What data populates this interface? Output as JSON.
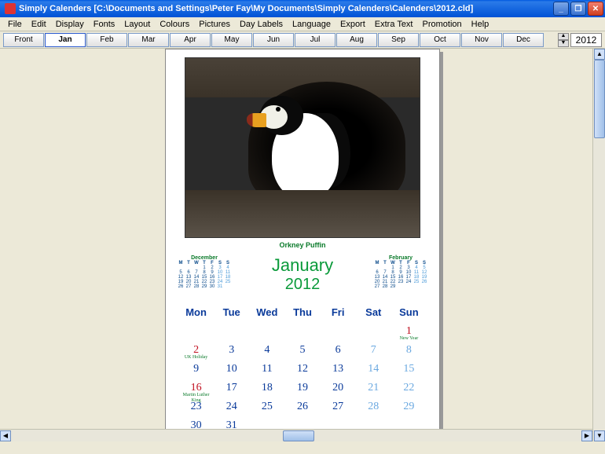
{
  "titlebar": {
    "text": "Simply Calenders [C:\\Documents and Settings\\Peter Fay\\My Documents\\Simply Calenders\\Calenders\\2012.cld]"
  },
  "menu": [
    "File",
    "Edit",
    "Display",
    "Fonts",
    "Layout",
    "Colours",
    "Pictures",
    "Day Labels",
    "Language",
    "Export",
    "Extra Text",
    "Promotion",
    "Help"
  ],
  "tabs": [
    "Front",
    "Jan",
    "Feb",
    "Mar",
    "Apr",
    "May",
    "Jun",
    "Jul",
    "Aug",
    "Sep",
    "Oct",
    "Nov",
    "Dec"
  ],
  "active_tab": "Jan",
  "year": "2012",
  "year_label": "January",
  "photo_caption": "Orkney Puffin",
  "main": {
    "month": "January",
    "year": "2012"
  },
  "day_headers": [
    "Mon",
    "Tue",
    "Wed",
    "Thu",
    "Fri",
    "Sat",
    "Sun"
  ],
  "mini_prev": {
    "name": "December",
    "head": [
      "M",
      "T",
      "W",
      "T",
      "F",
      "S",
      "S"
    ],
    "rows": [
      [
        "",
        "",
        "",
        "1",
        "2",
        "3",
        "4"
      ],
      [
        "5",
        "6",
        "7",
        "8",
        "9",
        "10",
        "11"
      ],
      [
        "12",
        "13",
        "14",
        "15",
        "16",
        "17",
        "18"
      ],
      [
        "19",
        "20",
        "21",
        "22",
        "23",
        "24",
        "25"
      ],
      [
        "26",
        "27",
        "28",
        "29",
        "30",
        "31",
        ""
      ]
    ]
  },
  "mini_next": {
    "name": "February",
    "head": [
      "M",
      "T",
      "W",
      "T",
      "F",
      "S",
      "S"
    ],
    "rows": [
      [
        "",
        "",
        "1",
        "2",
        "3",
        "4",
        "5"
      ],
      [
        "6",
        "7",
        "8",
        "9",
        "10",
        "11",
        "12"
      ],
      [
        "13",
        "14",
        "15",
        "16",
        "17",
        "18",
        "19"
      ],
      [
        "20",
        "21",
        "22",
        "23",
        "24",
        "25",
        "26"
      ],
      [
        "27",
        "28",
        "29",
        "",
        "",
        "",
        ""
      ]
    ]
  },
  "grid": [
    [
      {
        "d": ""
      },
      {
        "d": ""
      },
      {
        "d": ""
      },
      {
        "d": ""
      },
      {
        "d": ""
      },
      {
        "d": ""
      },
      {
        "d": "1",
        "hol": true,
        "note": "New Year"
      }
    ],
    [
      {
        "d": "2",
        "hol": true,
        "note": "UK Holiday"
      },
      {
        "d": "3"
      },
      {
        "d": "4"
      },
      {
        "d": "5"
      },
      {
        "d": "6"
      },
      {
        "d": "7",
        "we": true
      },
      {
        "d": "8",
        "we": true
      }
    ],
    [
      {
        "d": "9"
      },
      {
        "d": "10"
      },
      {
        "d": "11"
      },
      {
        "d": "12"
      },
      {
        "d": "13"
      },
      {
        "d": "14",
        "we": true
      },
      {
        "d": "15",
        "we": true
      }
    ],
    [
      {
        "d": "16",
        "hol": true,
        "note": "Martin Luther King"
      },
      {
        "d": "17"
      },
      {
        "d": "18"
      },
      {
        "d": "19"
      },
      {
        "d": "20"
      },
      {
        "d": "21",
        "we": true
      },
      {
        "d": "22",
        "we": true
      }
    ],
    [
      {
        "d": "23"
      },
      {
        "d": "24"
      },
      {
        "d": "25"
      },
      {
        "d": "26"
      },
      {
        "d": "27"
      },
      {
        "d": "28",
        "we": true
      },
      {
        "d": "29",
        "we": true
      }
    ],
    [
      {
        "d": "30"
      },
      {
        "d": "31"
      },
      {
        "d": ""
      },
      {
        "d": ""
      },
      {
        "d": ""
      },
      {
        "d": ""
      },
      {
        "d": ""
      }
    ]
  ]
}
